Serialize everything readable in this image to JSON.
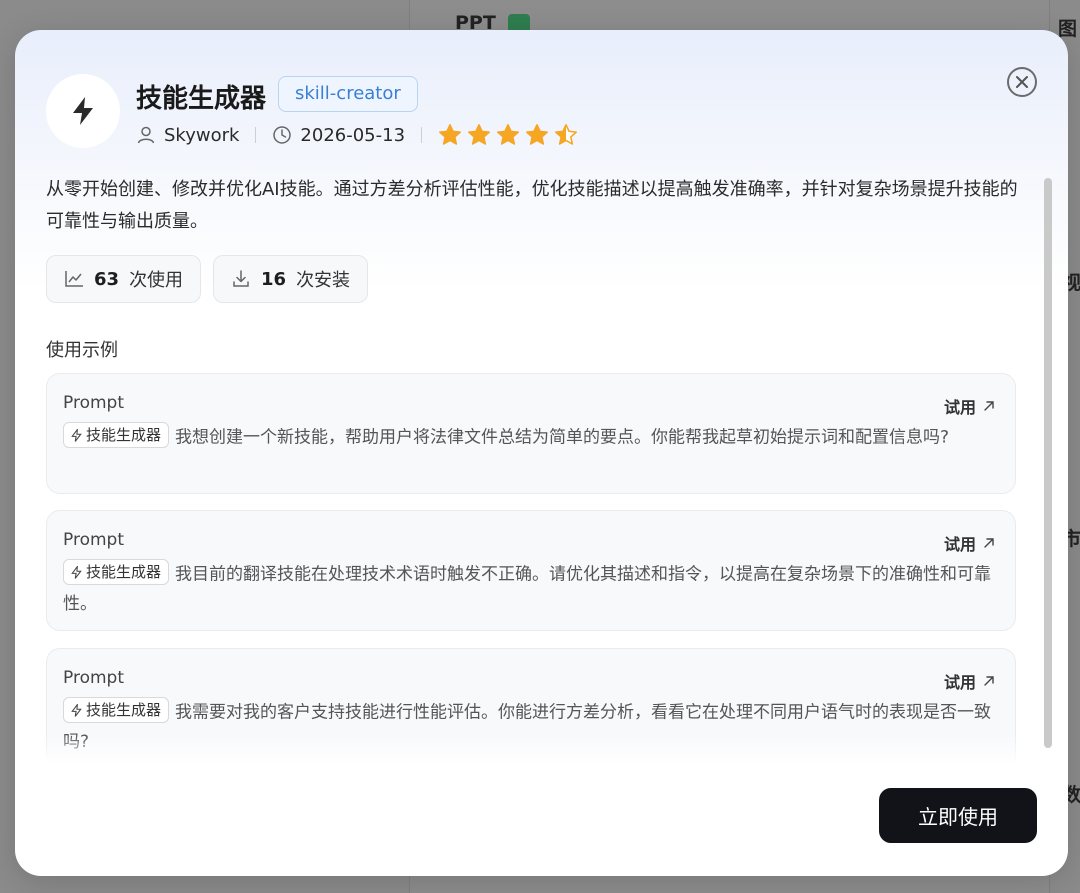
{
  "background": {
    "ppt_label": "PPT",
    "right_char_1": "图",
    "right_char_2": "视",
    "right_char_3": "市",
    "right_char_4": "数"
  },
  "skill": {
    "title": "技能生成器",
    "slug": "skill-creator",
    "author": "Skywork",
    "date": "2026-05-13",
    "rating": 4.5,
    "description": "从零开始创建、修改并优化AI技能。通过方差分析评估性能，优化技能描述以提高触发准确率，并针对复杂场景提升技能的可靠性与输出质量。",
    "icon": "lightning-icon"
  },
  "stats": {
    "uses_count": "63",
    "uses_label": "次使用",
    "installs_count": "16",
    "installs_label": "次安装"
  },
  "examples": {
    "section_title": "使用示例",
    "items": [
      {
        "label": "Prompt",
        "try_label": "试用",
        "chip": "技能生成器",
        "text": "我想创建一个新技能，帮助用户将法律文件总结为简单的要点。你能帮我起草初始提示词和配置信息吗?"
      },
      {
        "label": "Prompt",
        "try_label": "试用",
        "chip": "技能生成器",
        "text": "我目前的翻译技能在处理技术术语时触发不正确。请优化其描述和指令，以提高在复杂场景下的准确性和可靠性。"
      },
      {
        "label": "Prompt",
        "try_label": "试用",
        "chip": "技能生成器",
        "text": "我需要对我的客户支持技能进行性能评估。你能进行方差分析，看看它在处理不同用户语气时的表现是否一致吗?"
      }
    ]
  },
  "actions": {
    "use_now": "立即使用"
  },
  "colors": {
    "accent": "#3a7fd5",
    "star": "#f5a623",
    "primary_button": "#111318"
  }
}
